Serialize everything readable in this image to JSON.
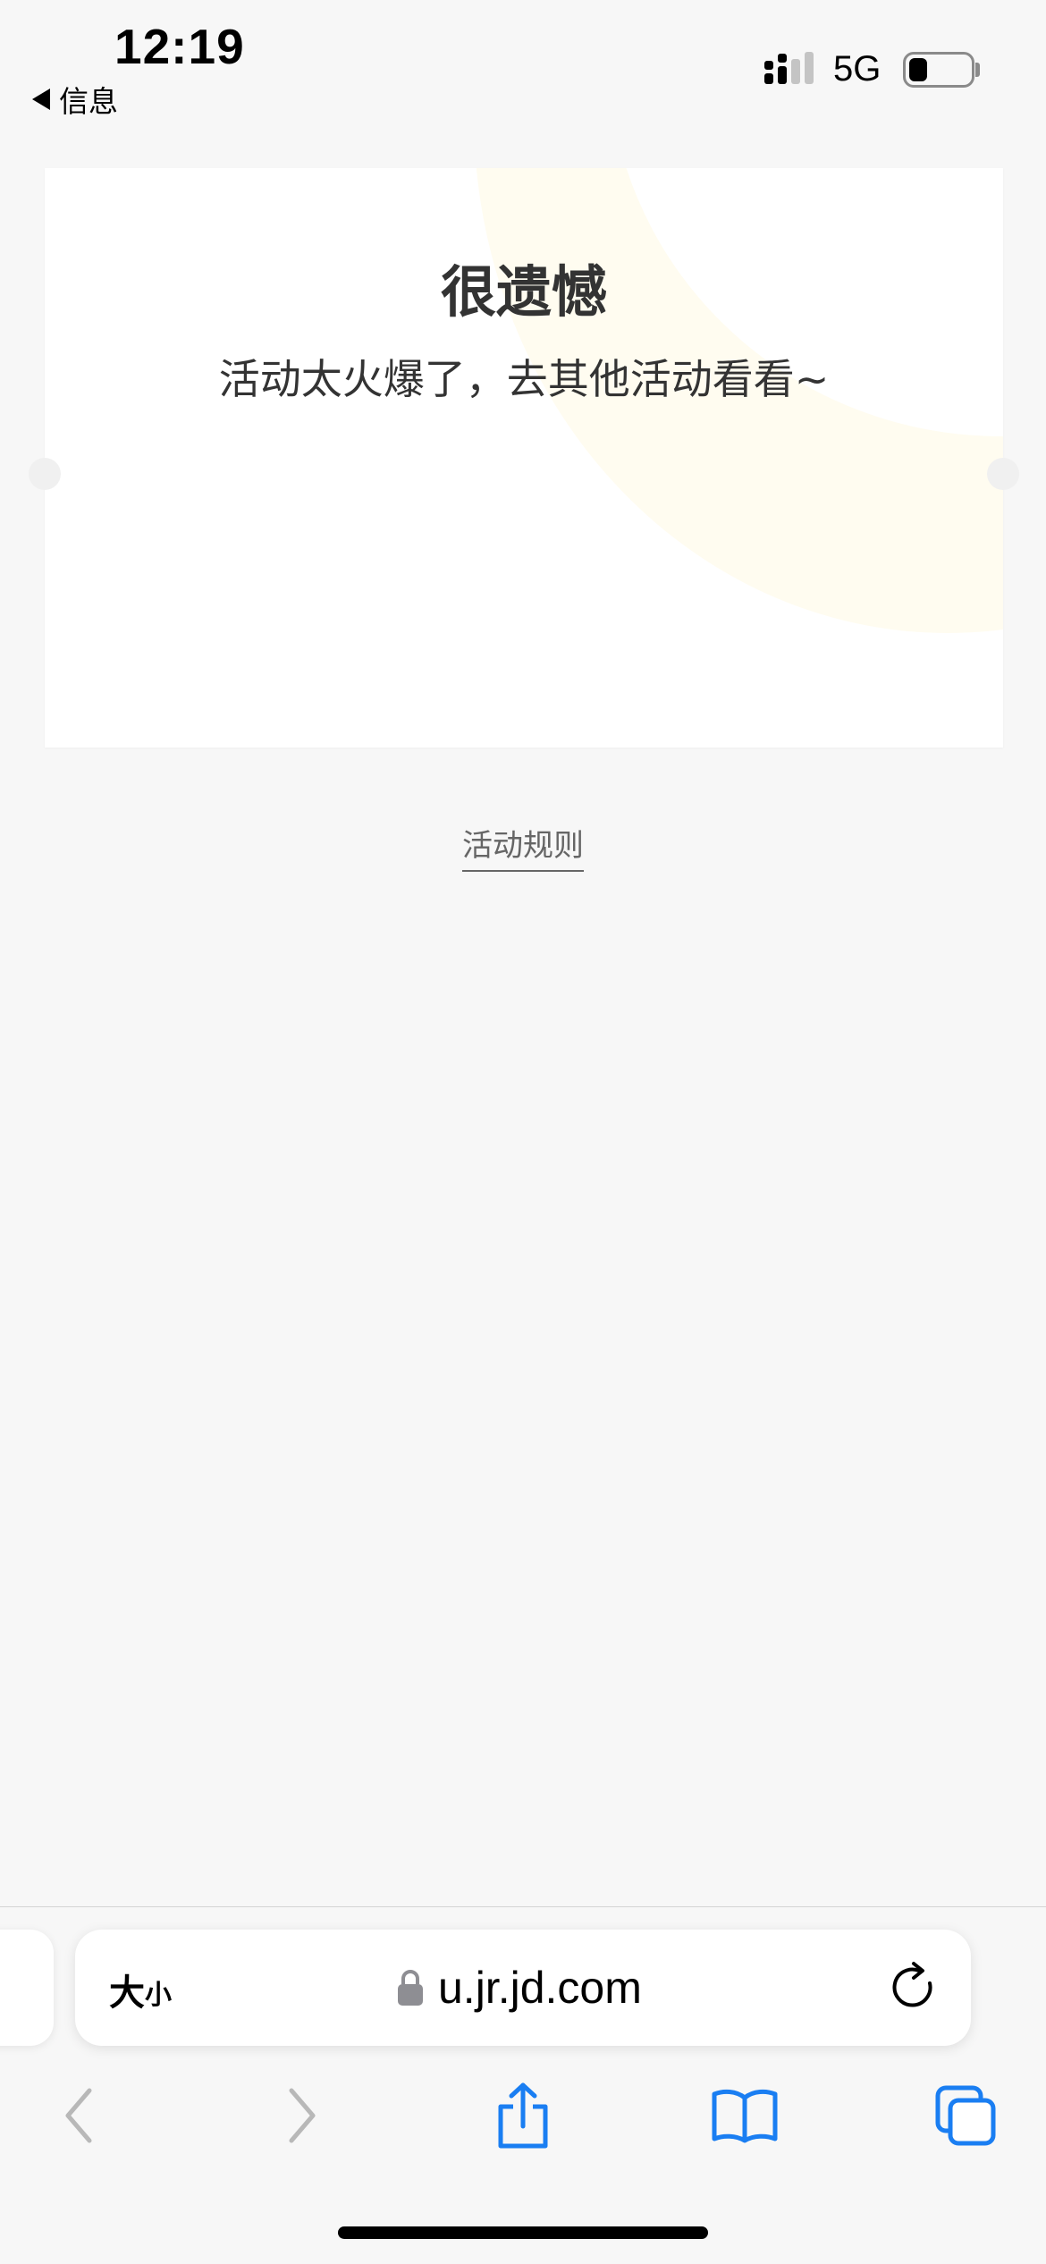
{
  "status_bar": {
    "time": "12:19",
    "back_app_label": "信息",
    "network": "5G"
  },
  "card": {
    "title": "很遗憾",
    "subtitle": "活动太火爆了，去其他活动看看~",
    "accent_color": "#fffcf0"
  },
  "rules_link": {
    "label": "活动规则"
  },
  "address_bar": {
    "text_size_big": "大",
    "text_size_small": "小",
    "url": "u.jr.jd.com"
  },
  "toolbar": {
    "back_icon": "chevron-left-icon",
    "forward_icon": "chevron-right-icon",
    "share_icon": "share-icon",
    "bookmarks_icon": "book-icon",
    "tabs_icon": "tabs-icon",
    "active_color": "#1a7ef2",
    "disabled_color": "#b8b8b8"
  }
}
